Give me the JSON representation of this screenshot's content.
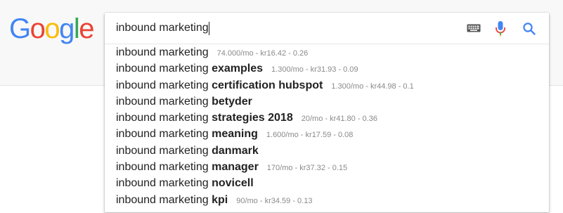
{
  "logo": {
    "letters": [
      "G",
      "o",
      "o",
      "g",
      "l",
      "e"
    ],
    "colors": [
      "#4285F4",
      "#EA4335",
      "#FBBC05",
      "#4285F4",
      "#34A853",
      "#EA4335"
    ]
  },
  "search": {
    "query": "inbound marketing",
    "icons": [
      "keyboard-icon",
      "microphone-icon",
      "search-icon"
    ]
  },
  "suggestions": [
    {
      "base": "inbound marketing",
      "bold": "",
      "meta": "74.000/mo - kr16.42 - 0.26"
    },
    {
      "base": "inbound marketing ",
      "bold": "examples",
      "meta": "1.300/mo - kr31.93 - 0.09"
    },
    {
      "base": "inbound marketing ",
      "bold": "certification hubspot",
      "meta": "1.300/mo - kr44.98 - 0.1"
    },
    {
      "base": "inbound marketing ",
      "bold": "betyder",
      "meta": ""
    },
    {
      "base": "inbound marketing ",
      "bold": "strategies 2018",
      "meta": "20/mo - kr41.80 - 0.36"
    },
    {
      "base": "inbound marketing ",
      "bold": "meaning",
      "meta": "1.600/mo - kr17.59 - 0.08"
    },
    {
      "base": "inbound marketing ",
      "bold": "danmark",
      "meta": ""
    },
    {
      "base": "inbound marketing ",
      "bold": "manager",
      "meta": "170/mo - kr37.32 - 0.15"
    },
    {
      "base": "inbound marketing ",
      "bold": "novicell",
      "meta": ""
    },
    {
      "base": "inbound marketing ",
      "bold": "kpi",
      "meta": "90/mo - kr34.59 - 0.13"
    }
  ],
  "colors": {
    "mic_blue": "#4285F4",
    "mic_red": "#EA4335",
    "search_icon_blue": "#4285F4",
    "meta_gray": "#8a8a8a"
  }
}
